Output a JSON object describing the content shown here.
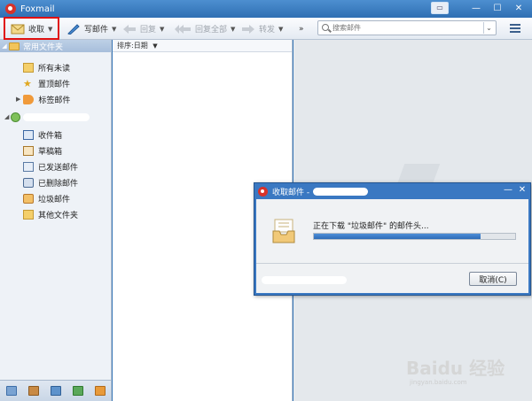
{
  "app": {
    "title": "Foxmail"
  },
  "toolbar": {
    "receive": "收取",
    "compose": "写邮件",
    "reply": "回复",
    "reply_all": "回复全部",
    "forward": "转发",
    "more": "»",
    "search_placeholder": "搜索邮件"
  },
  "sidebar": {
    "common_group": "常用文件夹",
    "common_items": [
      "所有未读",
      "置顶邮件",
      "标签邮件"
    ],
    "account_items": [
      "收件箱",
      "草稿箱",
      "已发送邮件",
      "已删除邮件",
      "垃圾邮件",
      "其他文件夹"
    ]
  },
  "mail_list": {
    "sort_label": "排序:日期"
  },
  "dialog": {
    "title": "收取邮件 -",
    "status": "正在下载 \"垃圾邮件\" 的邮件头...",
    "progress": 0.83,
    "cancel": "取消(C)"
  },
  "watermark": {
    "logo": "Baidu 经验",
    "url": "jingyan.baidu.com"
  }
}
